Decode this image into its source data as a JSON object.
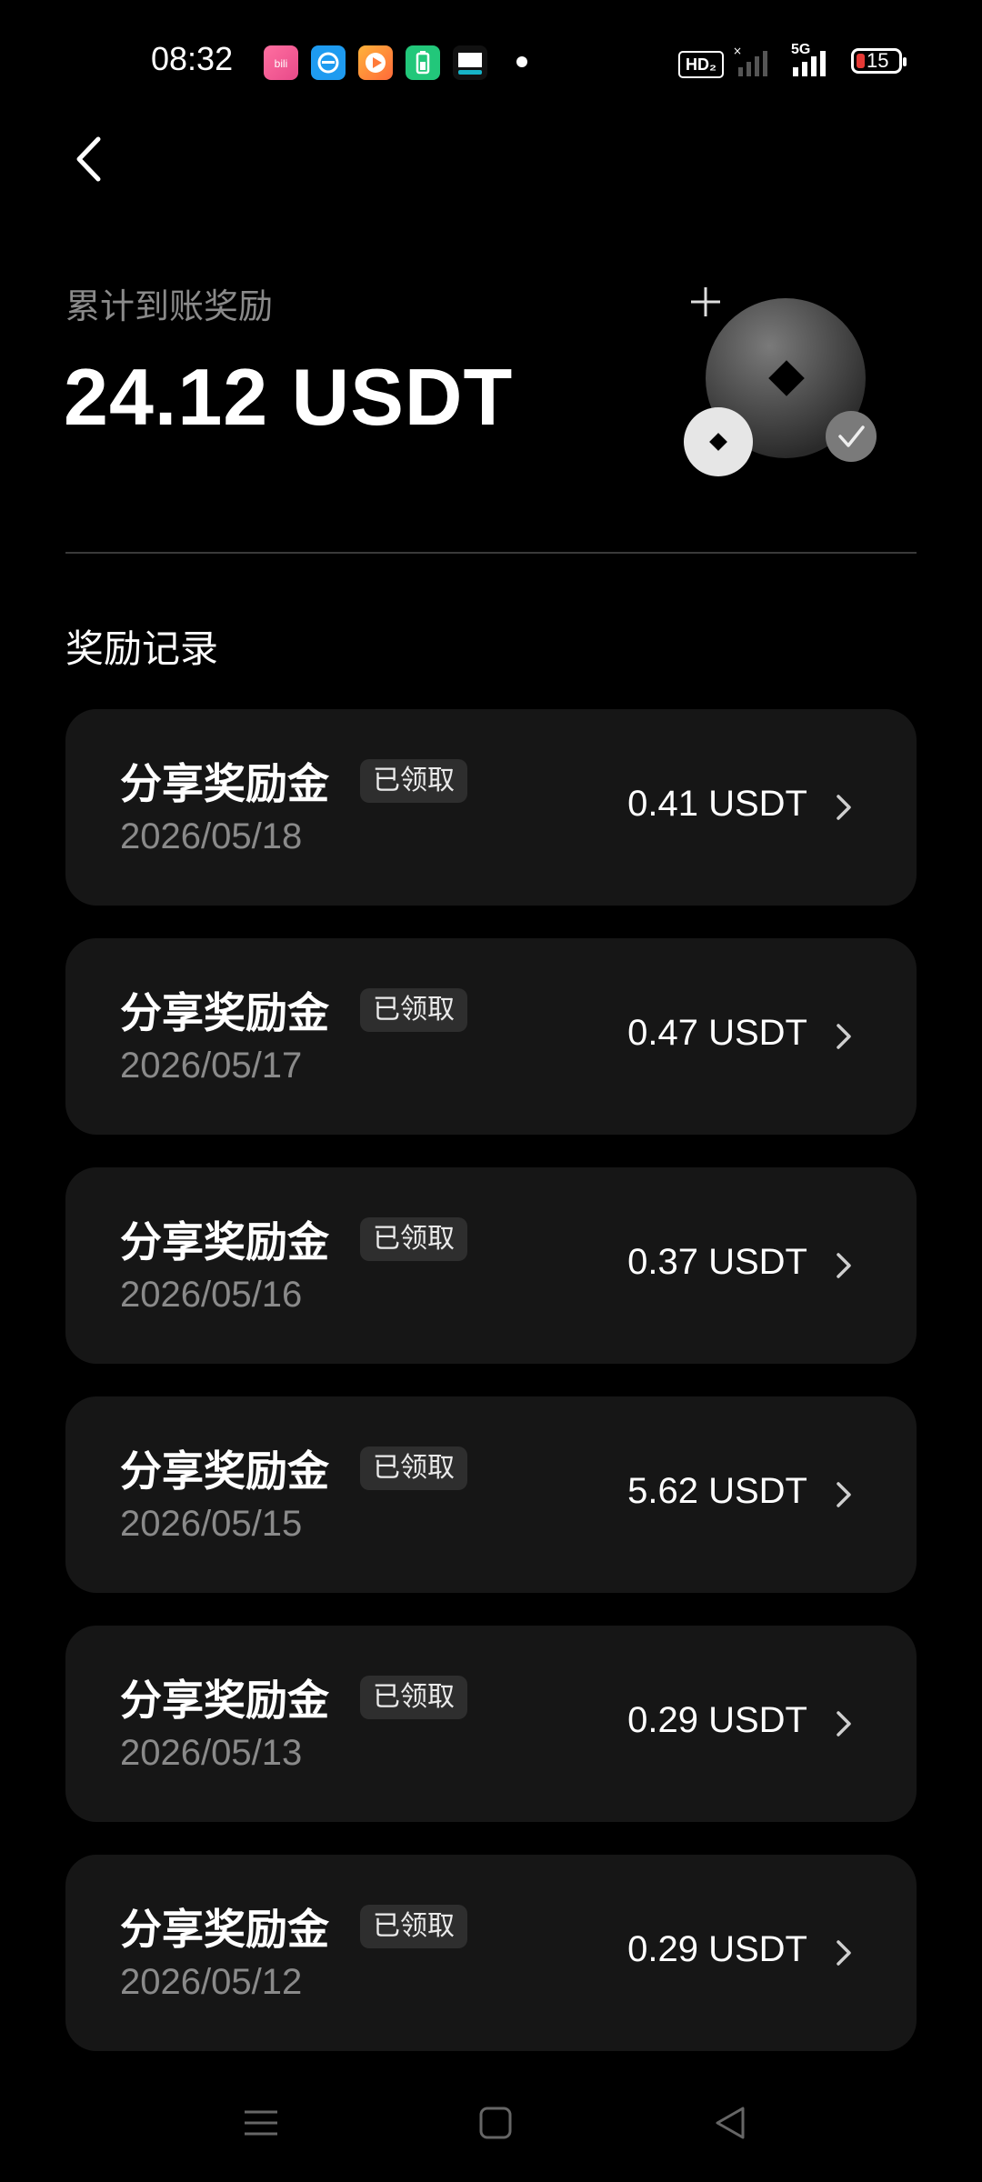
{
  "status_bar": {
    "time": "08:32",
    "hd_label": "HD₂",
    "network_label": "5G",
    "battery_level": "15",
    "battery_color": "#e53935",
    "app_icons": [
      "bilibili-icon",
      "browser-icon",
      "video-icon",
      "battery-app-icon",
      "news-icon"
    ]
  },
  "header": {
    "summary_label": "累计到账奖励",
    "summary_amount": "24.12 USDT"
  },
  "section": {
    "title": "奖励记录"
  },
  "records": [
    {
      "title": "分享奖励金",
      "badge": "已领取",
      "date": "2026/05/18",
      "amount": "0.41 USDT"
    },
    {
      "title": "分享奖励金",
      "badge": "已领取",
      "date": "2026/05/17",
      "amount": "0.47 USDT"
    },
    {
      "title": "分享奖励金",
      "badge": "已领取",
      "date": "2026/05/16",
      "amount": "0.37 USDT"
    },
    {
      "title": "分享奖励金",
      "badge": "已领取",
      "date": "2026/05/15",
      "amount": "5.62 USDT"
    },
    {
      "title": "分享奖励金",
      "badge": "已领取",
      "date": "2026/05/13",
      "amount": "0.29 USDT"
    },
    {
      "title": "分享奖励金",
      "badge": "已领取",
      "date": "2026/05/12",
      "amount": "0.29 USDT"
    }
  ],
  "colors": {
    "background": "#000000",
    "card": "#161616",
    "muted_text": "#8a8a8a",
    "badge_bg": "#2e2e2e"
  }
}
